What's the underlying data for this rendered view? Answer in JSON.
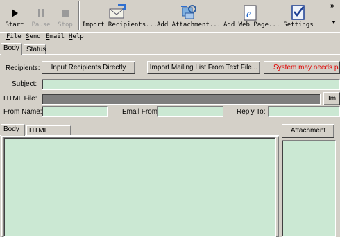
{
  "toolbar": {
    "start": "Start",
    "pause": "Pause",
    "stop": "Stop",
    "import_recipients": "Import Recipients...",
    "add_attachment": "Add Attachment...",
    "add_web_page": "Add Web Page...",
    "settings": "Settings",
    "more": "»"
  },
  "menu": {
    "file": {
      "key": "F",
      "rest": "ile"
    },
    "send": {
      "key": "S",
      "rest": "end"
    },
    "email": {
      "key": "E",
      "rest": "mail"
    },
    "help": {
      "key": "H",
      "rest": "elp"
    }
  },
  "top_tabs": [
    "Body",
    "Status"
  ],
  "form": {
    "recipients_label": "Recipients:",
    "import_directly": "Input Recipients Directly",
    "import_list": "Import Mailing List From Text File...",
    "system_warning": "System may needs patch",
    "subject_label": "Subject:",
    "html_file_label": "HTML File:",
    "html_file_button": "Im",
    "from_name_label": "From Name:",
    "email_from_label": "Email From:",
    "reply_to_label": "Reply To:"
  },
  "body_tabs": [
    "Body",
    "HTML Preview"
  ],
  "attachment_header": "Attachment",
  "colors": {
    "warning": "#e00000",
    "field_bg": "#cbe8d3"
  }
}
